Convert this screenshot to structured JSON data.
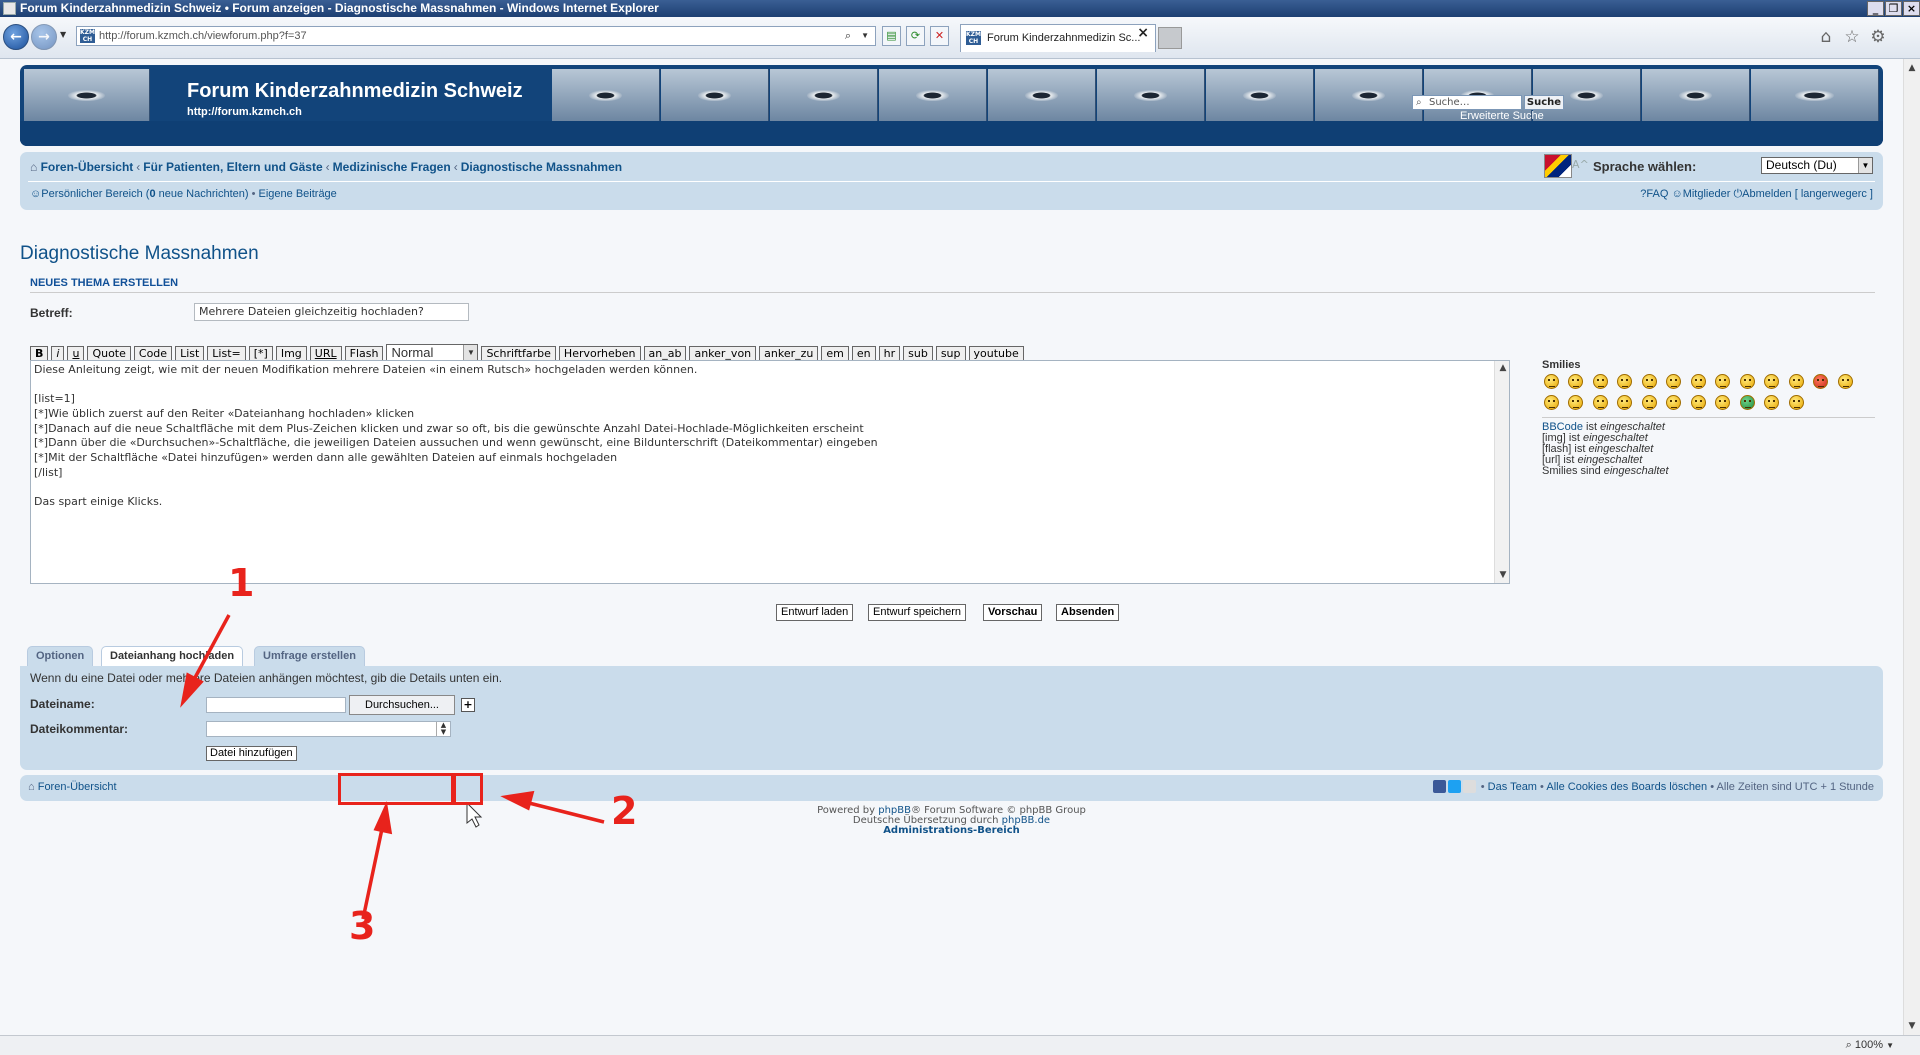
{
  "window": {
    "title": "Forum Kinderzahnmedizin Schweiz • Forum anzeigen - Diagnostische Massnahmen - Windows Internet Explorer"
  },
  "browser": {
    "url": "http://forum.kzmch.ch/viewforum.php?f=37",
    "tab_title": "Forum Kinderzahnmedizin Sc...",
    "favicon_text": "KZM CH",
    "zoom": "100%"
  },
  "header": {
    "site_title": "Forum Kinderzahnmedizin Schweiz",
    "site_url": "http://forum.kzmch.ch",
    "search_placeholder": "Suche…",
    "search_button": "Suche",
    "advanced_search": "Erweiterte Suche"
  },
  "navbar": {
    "breadcrumb": [
      "Foren-Übersicht",
      "Für Patienten, Eltern und Gäste",
      "Medizinische Fragen",
      "Diagnostische Massnahmen"
    ],
    "breadcrumb_sep": "‹",
    "language_label": "Sprache wählen:",
    "language_value": "Deutsch (Du)",
    "user_area_prefix": "Persönlicher Bereich (",
    "user_area_count": "0",
    "user_area_suffix": " neue Nachrichten)",
    "bullet": "•",
    "own_posts": "Eigene Beiträge",
    "faq": "FAQ",
    "members": "Mitglieder",
    "logout": "Abmelden [ langerwegerc ]",
    "resize": "∨A^"
  },
  "main": {
    "page_title": "Diagnostische Massnahmen",
    "section_heading": "NEUES THEMA ERSTELLEN",
    "subject_label": "Betreff:",
    "subject_value": "Mehrere Dateien gleichzeitig hochladen?"
  },
  "bbcode": {
    "buttons_before": [
      "B",
      "i",
      "u",
      "Quote",
      "Code",
      "List",
      "List=",
      "[*]",
      "Img",
      "URL",
      "Flash"
    ],
    "size_value": "Normal",
    "buttons_after": [
      "Schriftfarbe",
      "Hervorheben",
      "an_ab",
      "anker_von",
      "anker_zu",
      "em",
      "en",
      "hr",
      "sub",
      "sup",
      "youtube"
    ]
  },
  "message_lines": [
    "Diese Anleitung zeigt, wie mit der neuen Modifikation mehrere Dateien «in einem Rutsch» hochgeladen werden können.",
    "",
    "[list=1]",
    "[*]Wie üblich zuerst auf den Reiter «Dateianhang hochladen» klicken",
    "[*]Danach auf die neue Schaltfläche mit dem Plus-Zeichen klicken und zwar so oft, bis die gewünschte Anzahl Datei-Hochlade-Möglichkeiten erscheint",
    "[*]Dann über die «Durchsuchen»-Schaltfläche, die jeweiligen Dateien aussuchen und wenn gewünscht, eine Bildunterschrift (Dateikommentar) eingeben",
    "[*]Mit der Schaltfläche «Datei hinzufügen» werden dann alle gewählten Dateien auf einmals hochgeladen",
    "[/list]",
    "",
    "Das spart einige Klicks."
  ],
  "sidebar": {
    "smilies_heading": "Smilies",
    "status": [
      {
        "name": "BBCode",
        "mid": " ist ",
        "state": "eingeschaltet"
      },
      {
        "name": "[img]",
        "mid": " ist ",
        "state": "eingeschaltet"
      },
      {
        "name": "[flash]",
        "mid": " ist ",
        "state": "eingeschaltet"
      },
      {
        "name": "[url]",
        "mid": " ist ",
        "state": "eingeschaltet"
      },
      {
        "name": "Smilies",
        "mid": " sind ",
        "state": "eingeschaltet"
      }
    ]
  },
  "submit": {
    "load_draft": "Entwurf laden",
    "save_draft": "Entwurf speichern",
    "preview": "Vorschau",
    "submit": "Absenden"
  },
  "tabs": [
    "Optionen",
    "Dateianhang hochladen",
    "Umfrage erstellen"
  ],
  "attachment": {
    "intro": "Wenn du eine Datei oder mehrere Dateien anhängen möchtest, gib die Details unten ein.",
    "filename_label": "Dateiname:",
    "browse_button": "Durchsuchen...",
    "plus_button": "+",
    "comment_label": "Dateikommentar:",
    "add_file_button": "Datei hinzufügen"
  },
  "annotations": {
    "n1": "1",
    "n2": "2",
    "n3": "3",
    "color": "#e8231c"
  },
  "footer": {
    "home": "Foren-Übersicht",
    "team": "Das Team",
    "delete_cookies": "Alle Cookies des Boards löschen",
    "timezone": "Alle Zeiten sind UTC + 1 Stunde",
    "bullet": "•",
    "powered_prefix": "Powered by ",
    "powered_link": "phpBB",
    "powered_suffix": "® Forum Software © phpBB Group",
    "translation_prefix": "Deutsche Übersetzung durch ",
    "translation_link": "phpBB.de",
    "admin": "Administrations-Bereich"
  },
  "colors": {
    "brand": "#12447a",
    "panel": "#cadceb",
    "link": "#105289"
  }
}
